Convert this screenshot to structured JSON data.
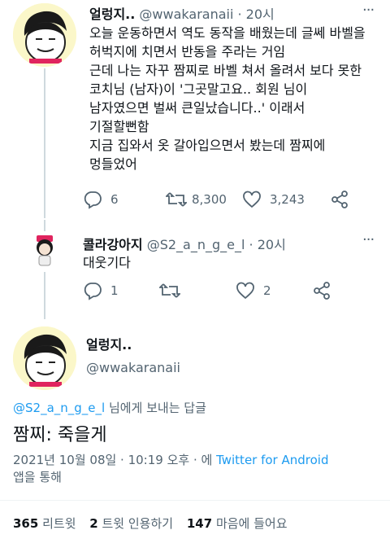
{
  "tweet1": {
    "name": "얼렁지..",
    "handle": "@wwakaranaii",
    "time": "· 20시",
    "text": "오늘 운동하면서 역도 동작을 배웠는데 글쎄 바벨을\n허벅지에 치면서 반동을 주라는 거임\n근데 나는 자꾸 짬찌로 바벨 쳐서 올려서 보다 못한\n코치님 (남자)이 '그곳말고요.. 회원 님이\n남자였으면 벌써 큰일났습니다..' 이래서\n기절할뻔함\n지금 집와서 옷 갈아입으면서 봤는데 짬찌에\n멍들었어",
    "replies": "6",
    "retweets": "8,300",
    "likes": "3,243"
  },
  "tweet2": {
    "name": "콜라강아지",
    "handle": "@S2_a_n_g_e_l",
    "time": "· 20시",
    "text": "대웃기다",
    "replies": "1",
    "retweets": "",
    "likes": "2"
  },
  "main": {
    "name": "얼렁지..",
    "handle": "@wwakaranaii",
    "reply_to_handle": "@S2_a_n_g_e_l",
    "reply_to_suffix": " 님에게 보내는 답글",
    "text": "짬찌: 죽을게",
    "timestamp": "2021년 10월 08일 · 10:19 오후 · 에 ",
    "source": "Twitter for Android",
    "source_suffix": "앱을 통해",
    "retweet_count": "365",
    "retweet_label": "리트윗",
    "quote_count": "2",
    "quote_label": "트윗 인용하기",
    "like_count": "147",
    "like_label": "마음에 들어요"
  },
  "colors": {
    "text": "#0f1419",
    "secondary": "#536471",
    "link": "#1d9bf0",
    "border": "#eff3f4",
    "thread": "#cfd9de"
  }
}
